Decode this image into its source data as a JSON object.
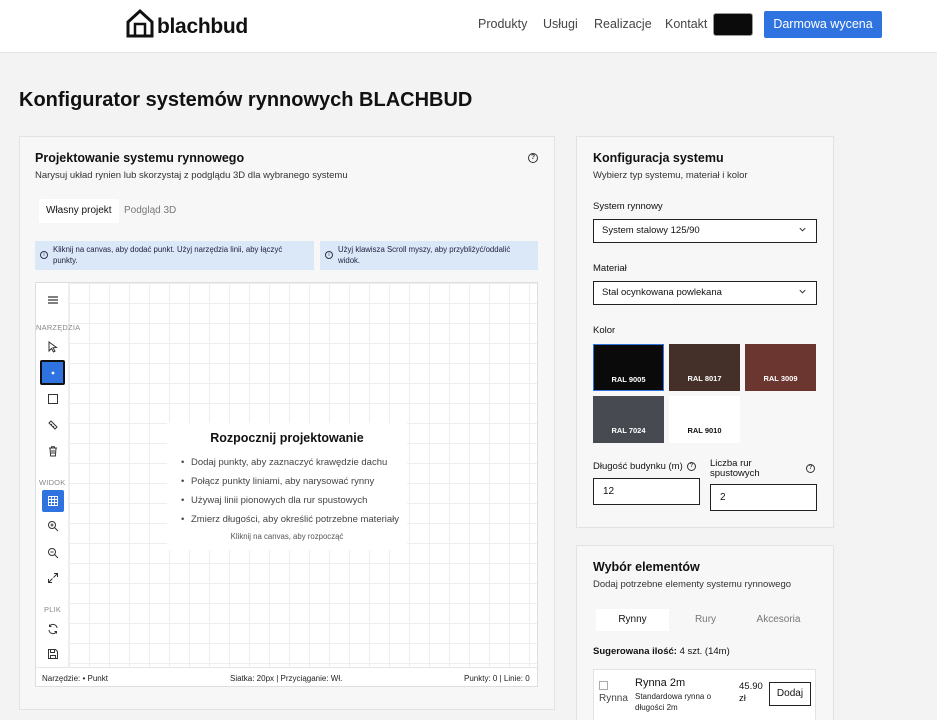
{
  "header": {
    "logo_text": "blachbud",
    "nav": [
      "Produkty",
      "Usługi",
      "Realizacje",
      "Kontakt"
    ],
    "cta": "Darmowa wycena"
  },
  "page": {
    "title": "Konfigurator systemów rynnowych BLACHBUD"
  },
  "designer": {
    "title": "Projektowanie systemu rynnowego",
    "subtitle": "Narysuj układ rynien lub skorzystaj z podglądu 3D dla wybranego systemu",
    "tabs": [
      "Własny projekt",
      "Podgląd 3D"
    ],
    "info_1": "Kliknij na canvas, aby dodać punkt. Użyj narzędzia linii, aby łączyć punkty.",
    "info_2": "Użyj klawisza Scroll myszy, aby przybliżyć/oddalić widok.",
    "toolbar_labels": {
      "tools": "NARZĘDZIA",
      "view": "WIDOK",
      "file": "PLIK"
    },
    "start": {
      "title": "Rozpocznij projektowanie",
      "steps": [
        "Dodaj punkty, aby zaznaczyć krawędzie dachu",
        "Połącz punkty liniami, aby narysować rynny",
        "Używaj linii pionowych dla rur spustowych",
        "Zmierz długości, aby określić potrzebne materiały"
      ],
      "hint": "Kliknij na canvas, aby rozpocząć"
    },
    "status": {
      "tool": "Narzędzie: • Punkt",
      "grid": "Siatka: 20px | Przyciąganie: Wł.",
      "counts": "Punkty: 0 | Linie: 0"
    }
  },
  "config": {
    "title": "Konfiguracja systemu",
    "subtitle": "Wybierz typ systemu, materiał i kolor",
    "system_label": "System rynnowy",
    "system_value": "System stalowy 125/90",
    "material_label": "Materiał",
    "material_value": "Stal ocynkowana powlekana",
    "color_label": "Kolor",
    "colors": [
      {
        "name": "RAL 9005",
        "hex": "#0a0a0a",
        "text": "#ffffff"
      },
      {
        "name": "RAL 8017",
        "hex": "#442f29",
        "text": "#ffffff"
      },
      {
        "name": "RAL 3009",
        "hex": "#6b3530",
        "text": "#ffffff"
      },
      {
        "name": "RAL 7024",
        "hex": "#474a51",
        "text": "#ffffff"
      },
      {
        "name": "RAL 9010",
        "hex": "#ffffff",
        "text": "#111111"
      }
    ],
    "length_label": "Długość budynku (m)",
    "length_value": "12",
    "downpipes_label": "Liczba rur spustowych",
    "downpipes_value": "2"
  },
  "elements": {
    "title": "Wybór elementów",
    "subtitle": "Dodaj potrzebne elementy systemu rynnowego",
    "tabs": [
      "Rynny",
      "Rury",
      "Akcesoria"
    ],
    "suggested_label": "Sugerowana ilość:",
    "suggested_value": "4 szt. (14m)",
    "product": {
      "image_alt": "Rynna",
      "name": "Rynna 2m",
      "desc": "Standardowa rynna o długości 2m",
      "price": "45.90",
      "currency": "zł",
      "add_label": "Dodaj"
    }
  }
}
